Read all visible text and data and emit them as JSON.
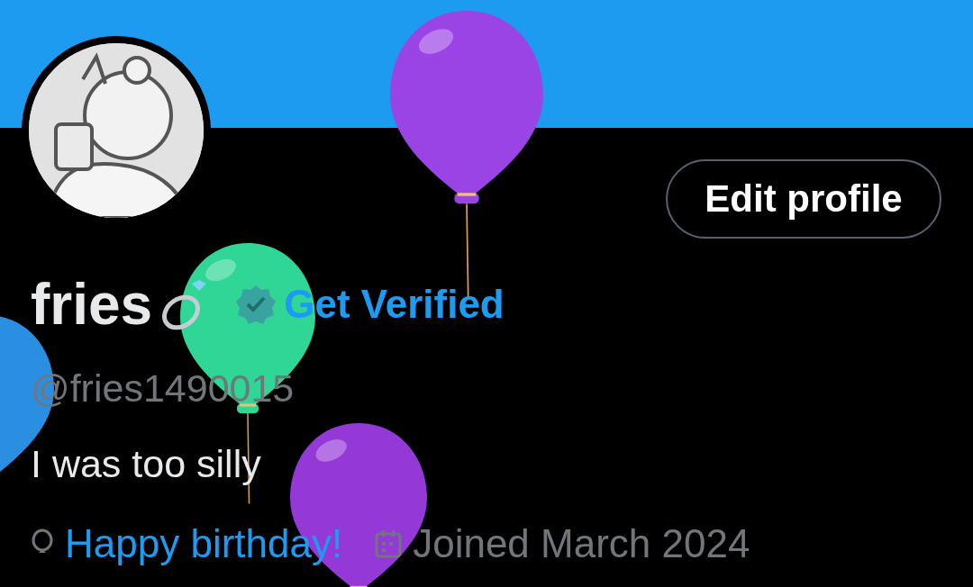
{
  "profile": {
    "name": "fries",
    "verify_link": "Get Verified",
    "handle": "@fries1490015",
    "bio": "I was too silly",
    "edit_button": "Edit profile"
  },
  "meta": [
    {
      "kind": "birthday",
      "text": "Happy birthday!"
    },
    {
      "kind": "joined",
      "text": "Joined March 2024"
    }
  ],
  "balloons": [
    {
      "color": "#9a44e6"
    },
    {
      "color": "#2fd696"
    },
    {
      "color": "#9538d8"
    },
    {
      "color": "#2a8fe0"
    }
  ]
}
